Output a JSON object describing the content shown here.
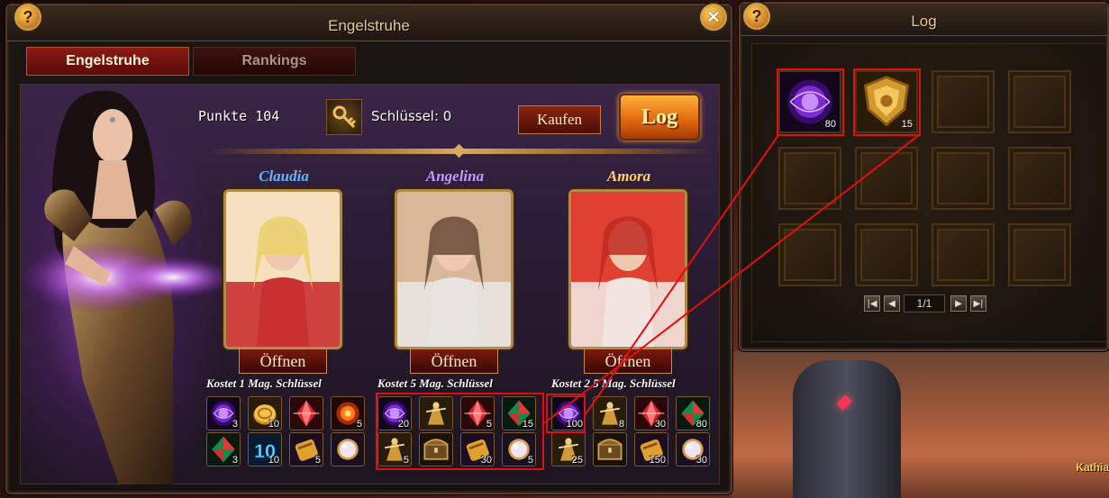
{
  "main_window": {
    "title": "Engelstruhe",
    "help_label": "?",
    "close_label": "✕",
    "tabs": [
      {
        "label": "Engelstruhe",
        "active": true
      },
      {
        "label": "Rankings",
        "active": false
      }
    ],
    "points_label": "Punkte 104",
    "keys_label": "Schlüssel: 0",
    "buy_label": "Kaufen",
    "log_label": "Log",
    "chests": [
      {
        "name": "Claudia",
        "name_color": "#62b6ff",
        "open_label": "Öffnen",
        "cost_label": "Kostet   1   Mag. Schlüssel",
        "items": [
          {
            "icon": "purple-orb-icon",
            "qty": "3"
          },
          {
            "icon": "gold-coin-icon",
            "qty": "10"
          },
          {
            "icon": "red-crystal-icon",
            "qty": ""
          },
          {
            "icon": "fire-orb-icon",
            "qty": "5"
          },
          {
            "icon": "green-gem-icon",
            "qty": "3"
          },
          {
            "icon": "vip-10-icon",
            "qty": "10"
          },
          {
            "icon": "gold-scroll-icon",
            "qty": "5"
          },
          {
            "icon": "pearl-icon",
            "qty": ""
          }
        ]
      },
      {
        "name": "Angelina",
        "name_color": "#c59aff",
        "open_label": "Öffnen",
        "cost_label": "Kostet   5   Mag. Schlüssel",
        "items": [
          {
            "icon": "purple-orb-icon",
            "qty": "20"
          },
          {
            "icon": "gold-figure-icon",
            "qty": ""
          },
          {
            "icon": "red-crystal-icon",
            "qty": "5"
          },
          {
            "icon": "green-gem-icon",
            "qty": "15"
          },
          {
            "icon": "gold-figure-icon",
            "qty": "5"
          },
          {
            "icon": "chest-icon",
            "qty": ""
          },
          {
            "icon": "gold-scroll-icon",
            "qty": "30"
          },
          {
            "icon": "pearl-icon",
            "qty": "5"
          }
        ]
      },
      {
        "name": "Amora",
        "name_color": "#ffd36a",
        "open_label": "Öffnen",
        "cost_label": "Kostet 2 5  Mag. Schlüssel",
        "items": [
          {
            "icon": "purple-orb-icon",
            "qty": "100"
          },
          {
            "icon": "gold-figure-icon",
            "qty": "8"
          },
          {
            "icon": "red-crystal-icon",
            "qty": "30"
          },
          {
            "icon": "green-gem-icon",
            "qty": "80"
          },
          {
            "icon": "gold-figure-icon",
            "qty": "25"
          },
          {
            "icon": "chest-icon",
            "qty": ""
          },
          {
            "icon": "gold-scroll-icon",
            "qty": "150"
          },
          {
            "icon": "pearl-icon",
            "qty": "30"
          }
        ]
      }
    ]
  },
  "log_window": {
    "title": "Log",
    "help_label": "?",
    "close_label": "✕",
    "slots": [
      {
        "icon": "purple-orb-icon",
        "qty": "80"
      },
      {
        "icon": "gold-shield-icon",
        "qty": "15"
      },
      {
        "icon": "",
        "qty": ""
      },
      {
        "icon": "",
        "qty": ""
      },
      {
        "icon": "",
        "qty": ""
      },
      {
        "icon": "",
        "qty": ""
      },
      {
        "icon": "",
        "qty": ""
      },
      {
        "icon": "",
        "qty": ""
      },
      {
        "icon": "",
        "qty": ""
      },
      {
        "icon": "",
        "qty": ""
      },
      {
        "icon": "",
        "qty": ""
      },
      {
        "icon": "",
        "qty": ""
      }
    ],
    "page_label": "1/1"
  },
  "scene": {
    "character_name": "Kathia"
  },
  "colors": {
    "highlight": "#e01010",
    "accent_gold": "#e9c98e"
  }
}
